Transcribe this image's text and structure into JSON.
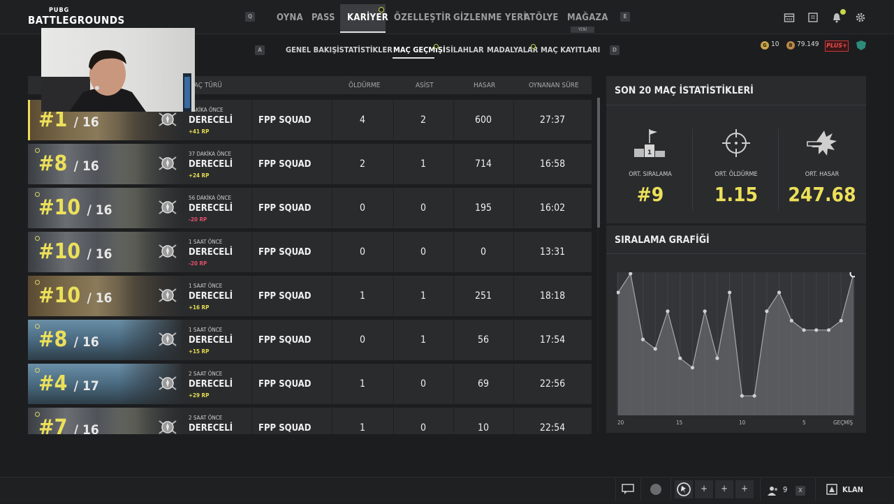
{
  "logo": {
    "line1": "PUBG",
    "line2": "BATTLEGROUNDS"
  },
  "top_nav": {
    "key_left": "Q",
    "key_right": "E",
    "items": [
      {
        "label": "OYNA"
      },
      {
        "label": "PASS"
      },
      {
        "label": "KARİYER",
        "active": true
      },
      {
        "label": "ÖZELLEŞTİR"
      },
      {
        "label": "GİZLENME YERİ"
      },
      {
        "label": "ATÖLYE"
      },
      {
        "label": "MAĞAZA",
        "badge": "YENİ"
      }
    ]
  },
  "top_icons": [
    "calendar-icon",
    "mail-icon",
    "bell-icon",
    "gear-icon"
  ],
  "sub_nav": {
    "key_left": "A",
    "key_right": "D",
    "items": [
      {
        "label": "GENEL BAKIŞ"
      },
      {
        "label": "İSTATİSTİKLER"
      },
      {
        "label": "MAÇ GEÇMİŞİ",
        "active": true
      },
      {
        "label": "SİLAHLAR"
      },
      {
        "label": "MADALYALAR"
      },
      {
        "label": "MAÇ KAYITLARI"
      }
    ]
  },
  "currency": {
    "gcoin": "10",
    "bp": "79.149",
    "plus_badge": "PLUS+"
  },
  "table": {
    "headers": {
      "type": "MAÇ TÜRÜ",
      "kills": "ÖLDÜRME",
      "assists": "ASİST",
      "damage": "HASAR",
      "time": "OYNANAN SÜRE"
    },
    "rows": [
      {
        "rank": "#1",
        "total": "/ 16",
        "ago": "DAKİKA ÖNCE",
        "mode": "DERECELİ",
        "rp": "+41 RP",
        "rp_color": "#e6dc52",
        "squad": "FPP SQUAD",
        "kills": "4",
        "assists": "2",
        "damage": "600",
        "time": "27:37",
        "map": "desert"
      },
      {
        "rank": "#8",
        "total": "/ 16",
        "ago": "37 DAKİKA ÖNCE",
        "mode": "DERECELİ",
        "rp": "+24 RP",
        "rp_color": "#e6dc52",
        "squad": "FPP SQUAD",
        "kills": "2",
        "assists": "1",
        "damage": "714",
        "time": "16:58",
        "map": "city"
      },
      {
        "rank": "#10",
        "total": "/ 16",
        "ago": "56 DAKİKA ÖNCE",
        "mode": "DERECELİ",
        "rp": "-20 RP",
        "rp_color": "#e0506a",
        "squad": "FPP SQUAD",
        "kills": "0",
        "assists": "0",
        "damage": "195",
        "time": "16:02",
        "map": "city"
      },
      {
        "rank": "#10",
        "total": "/ 16",
        "ago": "1 SAAT ÖNCE",
        "mode": "DERECELİ",
        "rp": "-20 RP",
        "rp_color": "#e0506a",
        "squad": "FPP SQUAD",
        "kills": "0",
        "assists": "0",
        "damage": "0",
        "time": "13:31",
        "map": "city"
      },
      {
        "rank": "#10",
        "total": "/ 16",
        "ago": "1 SAAT ÖNCE",
        "mode": "DERECELİ",
        "rp": "+16 RP",
        "rp_color": "#e6dc52",
        "squad": "FPP SQUAD",
        "kills": "1",
        "assists": "1",
        "damage": "251",
        "time": "18:18",
        "map": "desert"
      },
      {
        "rank": "#8",
        "total": "/ 16",
        "ago": "1 SAAT ÖNCE",
        "mode": "DERECELİ",
        "rp": "+15 RP",
        "rp_color": "#e6dc52",
        "squad": "FPP SQUAD",
        "kills": "0",
        "assists": "1",
        "damage": "56",
        "time": "17:54",
        "map": "mountain"
      },
      {
        "rank": "#4",
        "total": "/ 17",
        "ago": "2 SAAT ÖNCE",
        "mode": "DERECELİ",
        "rp": "+29 RP",
        "rp_color": "#e6dc52",
        "squad": "FPP SQUAD",
        "kills": "1",
        "assists": "0",
        "damage": "69",
        "time": "22:56",
        "map": "mountain"
      },
      {
        "rank": "#7",
        "total": "/ 16",
        "ago": "2 SAAT ÖNCE",
        "mode": "DERECELİ",
        "rp": "",
        "rp_color": "#e6dc52",
        "squad": "FPP SQUAD",
        "kills": "1",
        "assists": "0",
        "damage": "10",
        "time": "22:54",
        "map": "city"
      }
    ]
  },
  "summary": {
    "title": "SON 20 MAÇ İSTATİSTİKLERİ",
    "stats": [
      {
        "label": "ORT. SIRALAMA",
        "value": "#9",
        "icon": "podium-icon"
      },
      {
        "label": "ORT. ÖLDÜRME",
        "value": "1.15",
        "icon": "crosshair-icon"
      },
      {
        "label": "ORT. HASAR",
        "value": "247.68",
        "icon": "bullet-icon"
      }
    ]
  },
  "rank_chart": {
    "title": "SIRALAMA GRAFİĞİ",
    "x_labels": [
      "20",
      "15",
      "10",
      "5",
      "GEÇMİŞ"
    ]
  },
  "chart_data": {
    "type": "area",
    "title": "SIRALAMA GRAFİĞİ",
    "x": [
      20,
      19,
      18,
      17,
      16,
      15,
      14,
      13,
      12,
      11,
      10,
      9,
      8,
      7,
      6,
      5,
      4,
      3,
      2,
      1
    ],
    "series": [
      {
        "values": [
          3,
          1,
          8,
          9,
          5,
          10,
          11,
          5,
          10,
          3,
          14,
          14,
          5,
          3,
          6,
          7,
          7,
          7,
          6,
          1
        ]
      }
    ],
    "ylim": [
      1,
      16
    ],
    "y_inverted": true,
    "grid": true
  },
  "bottom_bar": {
    "party_count": "9",
    "clan_label": "KLAN",
    "key_x": "X"
  },
  "colors": {
    "accent_yellow": "#ece05a",
    "rp_negative": "#e0506a",
    "panel": "#2a2b2d",
    "background": "#1c1d1f"
  }
}
